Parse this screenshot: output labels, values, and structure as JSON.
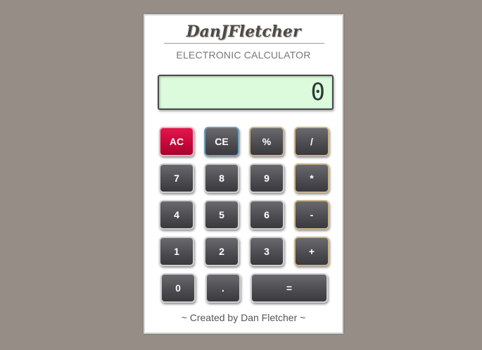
{
  "header": {
    "brand": "DanJFletcher",
    "subtitle": "ELECTRONIC CALCULATOR"
  },
  "display": {
    "value": "0"
  },
  "keys": {
    "ac": "AC",
    "ce": "CE",
    "percent": "%",
    "divide": "/",
    "seven": "7",
    "eight": "8",
    "nine": "9",
    "multiply": "*",
    "four": "4",
    "five": "5",
    "six": "6",
    "minus": "-",
    "one": "1",
    "two": "2",
    "three": "3",
    "plus": "+",
    "zero": "0",
    "decimal": ".",
    "equals": "="
  },
  "footer": {
    "credit": "~ Created by Dan Fletcher ~"
  },
  "colors": {
    "page_background": "#968d87",
    "display_background": "#dbfbdc",
    "ac_button": "#c8073a",
    "button": "#4e4d52"
  }
}
